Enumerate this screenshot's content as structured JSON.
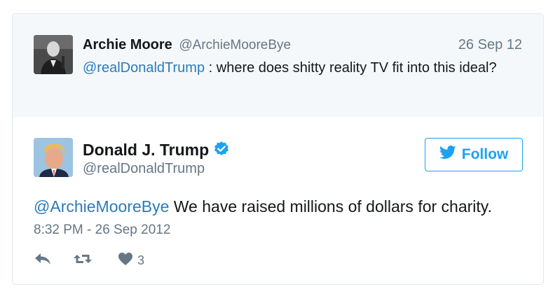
{
  "context_tweet": {
    "author_name": "Archie Moore",
    "author_handle": "@ArchieMooreBye",
    "date": "26 Sep 12",
    "mention": "@realDonaldTrump",
    "text": " : where does shitty reality TV fit into this ideal?"
  },
  "main_tweet": {
    "author_name": "Donald J. Trump",
    "author_handle": "@realDonaldTrump",
    "verified": true,
    "follow_label": "Follow",
    "mention": "@ArchieMooreBye",
    "text": " We have raised millions of dollars for charity.",
    "timestamp": "8:32 PM - 26 Sep 2012",
    "like_count": "3"
  },
  "colors": {
    "link": "#2b7bb9",
    "twitter_blue": "#1da1f2",
    "secondary_text": "#657786",
    "context_bg": "#f5f8fa"
  },
  "icons": [
    "avatar",
    "verified-badge-icon",
    "twitter-bird-icon",
    "reply-icon",
    "retweet-icon",
    "heart-icon"
  ]
}
